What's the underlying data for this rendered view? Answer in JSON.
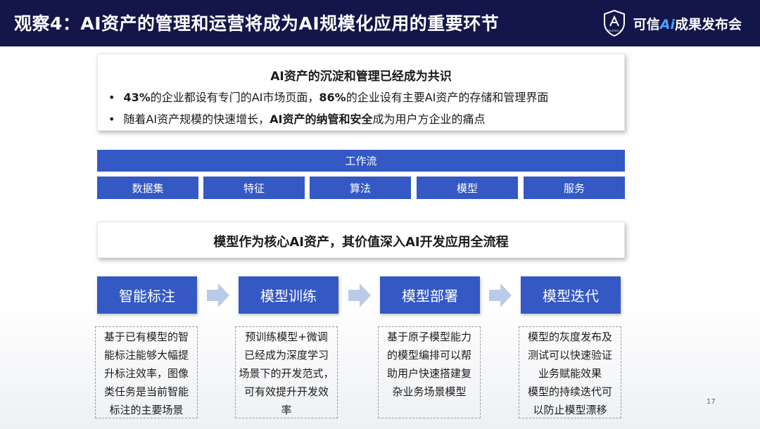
{
  "header": {
    "title": "观察4：AI资产的管理和运营将成为AI规模化应用的重要环节",
    "brand_prefix": "可信",
    "brand_ai": "Ai",
    "brand_suffix": "成果发布会",
    "logo_icon": "trusted-ai-shield-icon",
    "logo_text": "TRUSTED AI"
  },
  "card1": {
    "title": "AI资产的沉淀和管理已经成为共识",
    "bullet1": {
      "dot": "•",
      "p1": "43%",
      "p2": "的企业都设有专门的AI市场页面，",
      "p3": "86%",
      "p4": "的企业设有主要AI资产的存储和管理界面"
    },
    "bullet2": {
      "dot": "•",
      "p1": "随着AI资产规模的快速增长，",
      "p2": "AI资产的纳管和安全",
      "p3": "成为用户方企业的痛点"
    }
  },
  "workflow": {
    "label": "工作流",
    "items": [
      "数据集",
      "特征",
      "算法",
      "模型",
      "服务"
    ]
  },
  "card2": {
    "title": "模型作为核心AI资产，其价值深入AI开发应用全流程"
  },
  "steps": [
    {
      "label": "智能标注",
      "lines": [
        "基于已有模型的智",
        "能标注能够大幅提",
        "升标注效率，图像",
        "类任务是当前智能",
        "标注的主要场景"
      ]
    },
    {
      "label": "模型训练",
      "lines": [
        "预训练模型+微调",
        "已经成为深度学习",
        "场景下的开发范式，",
        "可有效提升开发效",
        "率"
      ]
    },
    {
      "label": "模型部署",
      "lines": [
        "基于原子模型能力",
        "的模型编排可以帮",
        "助用户快速搭建复",
        "杂业务场景模型"
      ]
    },
    {
      "label": "模型迭代",
      "lines": [
        "模型的灰度发布及",
        "测试可以快速验证",
        "业务赋能效果",
        "模型的持续迭代可",
        "以防止模型漂移"
      ]
    }
  ],
  "page_number": "17",
  "colors": {
    "header_bg": "#12164a",
    "accent_blue": "#3459c4",
    "arrow": "#b9cbe8"
  }
}
